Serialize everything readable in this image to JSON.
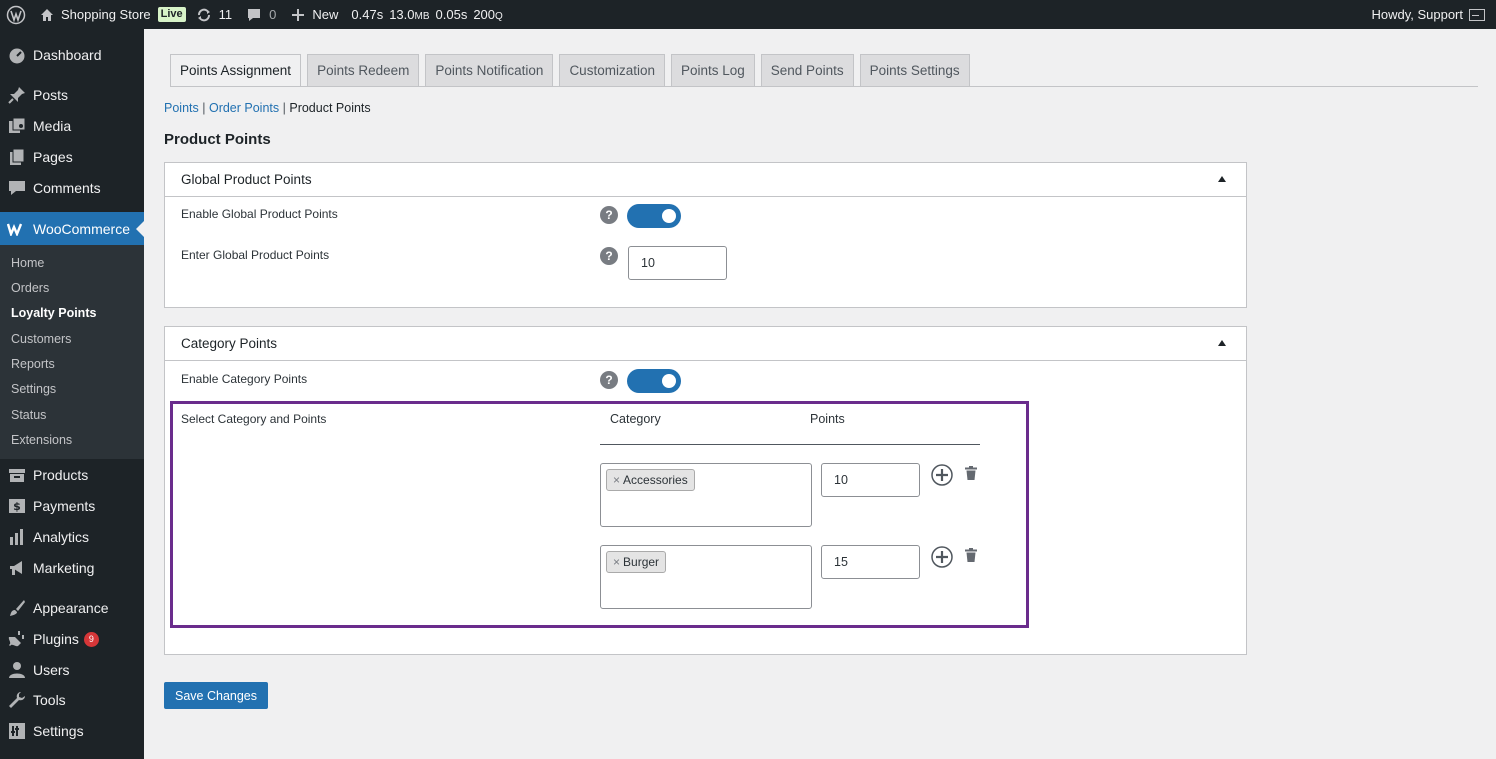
{
  "adminbar": {
    "site_name": "Shopping Store",
    "live_label": "Live",
    "updates_count": "11",
    "comments_count": "0",
    "new_label": "New",
    "stat_time": "0.47s",
    "stat_memory": "13.0",
    "stat_memory_unit": "MB",
    "stat_query_time": "0.05s",
    "stat_queries": "200",
    "stat_queries_unit": "Q",
    "howdy": "Howdy, Support"
  },
  "sidebar": {
    "dashboard": "Dashboard",
    "posts": "Posts",
    "media": "Media",
    "pages": "Pages",
    "comments": "Comments",
    "woocommerce": "WooCommerce",
    "submenu": [
      "Home",
      "Orders",
      "Loyalty Points",
      "Customers",
      "Reports",
      "Settings",
      "Status",
      "Extensions"
    ],
    "products": "Products",
    "payments": "Payments",
    "analytics": "Analytics",
    "marketing": "Marketing",
    "appearance": "Appearance",
    "plugins": "Plugins",
    "plugins_badge": "9",
    "users": "Users",
    "tools": "Tools",
    "settings": "Settings"
  },
  "tabs": [
    "Points Assignment",
    "Points Redeem",
    "Points Notification",
    "Customization",
    "Points Log",
    "Send Points",
    "Points Settings"
  ],
  "subnav": {
    "points": "Points",
    "order_points": "Order Points",
    "current": "Product Points",
    "sep": "|"
  },
  "page_title": "Product Points",
  "global_panel": {
    "title": "Global Product Points",
    "enable_label": "Enable Global Product Points",
    "enable_on": true,
    "points_label": "Enter Global Product Points",
    "points_value": "10"
  },
  "category_panel": {
    "title": "Category Points",
    "enable_label": "Enable Category Points",
    "enable_on": true,
    "select_label": "Select Category and Points",
    "col_category": "Category",
    "col_points": "Points",
    "rows": [
      {
        "category": "Accessories",
        "points": "10"
      },
      {
        "category": "Burger",
        "points": "15"
      }
    ]
  },
  "help_glyph": "?",
  "chip_remove_glyph": "×",
  "save_label": "Save Changes",
  "colors": {
    "primary": "#2271b1",
    "admin_dark": "#1d2327",
    "highlight": "#6a2c8c",
    "badge_red": "#d63638"
  }
}
